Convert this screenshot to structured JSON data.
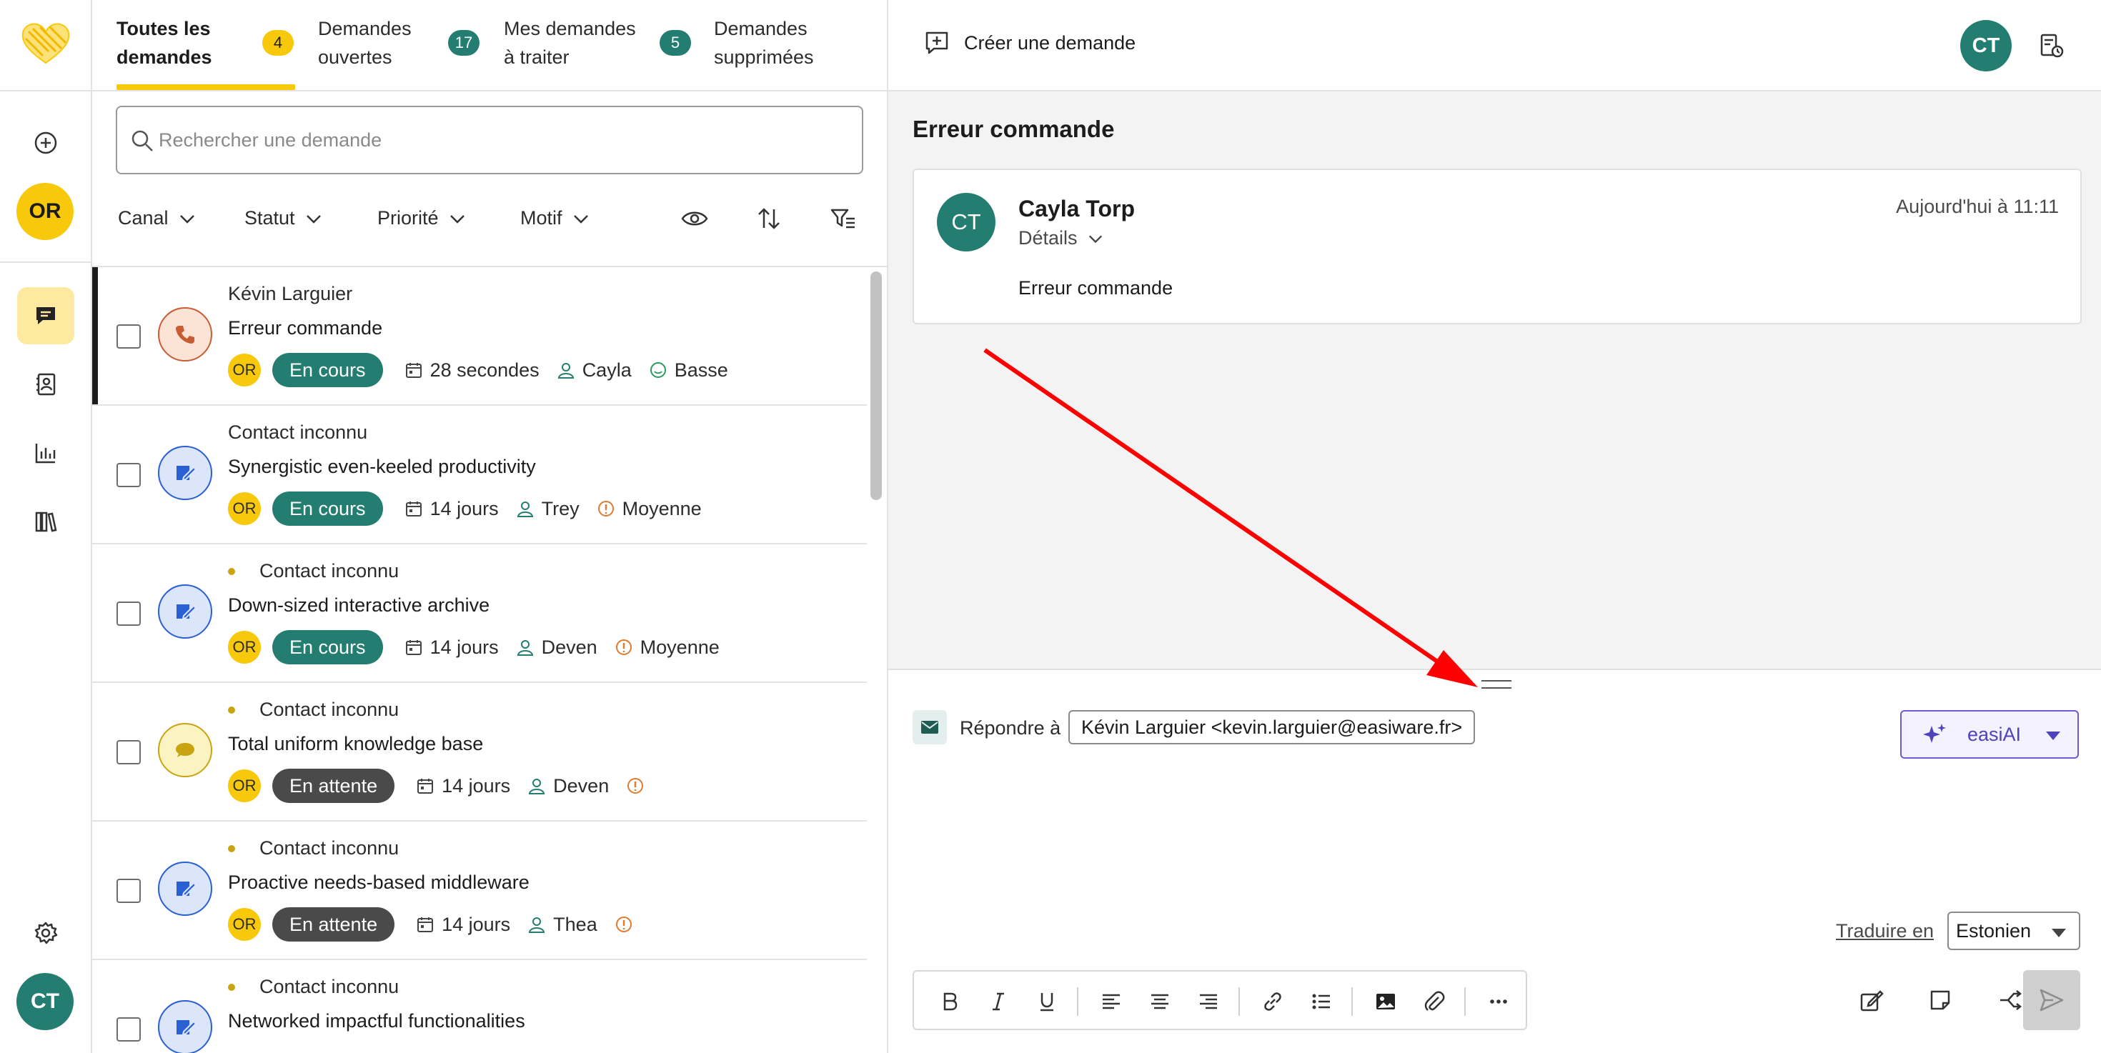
{
  "rail": {
    "user_initials": "OR",
    "agent_initials": "CT",
    "icons": [
      "add-circle-icon",
      "chat-icon",
      "contacts-icon",
      "stats-icon",
      "library-icon",
      "gear-icon"
    ]
  },
  "tabs": [
    {
      "label_line1": "Toutes les",
      "label_line2": "demandes",
      "count": "4"
    },
    {
      "label_line1": "Demandes",
      "label_line2": "ouvertes",
      "count": "17"
    },
    {
      "label_line1": "Mes demandes",
      "label_line2": "à traiter",
      "count": "5"
    },
    {
      "label_line1": "Demandes",
      "label_line2": "supprimées",
      "count": ""
    }
  ],
  "search": {
    "placeholder": "Rechercher une demande"
  },
  "filters": [
    "Canal",
    "Statut",
    "Priorité",
    "Motif"
  ],
  "requests": [
    {
      "contact": "Kévin Larguier",
      "subject": "Erreur commande",
      "owner": "OR",
      "status": "En cours",
      "age": "28 secondes",
      "assignee": "Cayla",
      "priority": "Basse",
      "channel": "phone",
      "unread": false
    },
    {
      "contact": "Contact inconnu",
      "subject": "Synergistic even-keeled productivity",
      "owner": "OR",
      "status": "En cours",
      "age": "14 jours",
      "assignee": "Trey",
      "priority": "Moyenne",
      "channel": "web",
      "unread": false
    },
    {
      "contact": "Contact inconnu",
      "subject": "Down-sized interactive archive",
      "owner": "OR",
      "status": "En cours",
      "age": "14 jours",
      "assignee": "Deven",
      "priority": "Moyenne",
      "channel": "web",
      "unread": true
    },
    {
      "contact": "Contact inconnu",
      "subject": "Total uniform knowledge base",
      "owner": "OR",
      "status": "En attente",
      "age": "14 jours",
      "assignee": "Deven",
      "priority": "",
      "channel": "chat",
      "unread": true
    },
    {
      "contact": "Contact inconnu",
      "subject": "Proactive needs-based middleware",
      "owner": "OR",
      "status": "En attente",
      "age": "14 jours",
      "assignee": "Thea",
      "priority": "",
      "channel": "web",
      "unread": true
    },
    {
      "contact": "Contact inconnu",
      "subject": "Networked impactful functionalities",
      "owner": "",
      "status": "",
      "age": "",
      "assignee": "",
      "priority": "",
      "channel": "web",
      "unread": true
    }
  ],
  "header": {
    "create_label": "Créer une demande",
    "agent_initials": "CT"
  },
  "conversation": {
    "title": "Erreur commande",
    "message": {
      "initials": "CT",
      "author": "Cayla Torp",
      "details_label": "Détails",
      "time": "Aujourd'hui à 11:11",
      "body": "Erreur commande"
    }
  },
  "reply": {
    "label": "Répondre à",
    "recipient": "Kévin Larguier <kevin.larguier@easiware.fr>",
    "ai_label": "easiAI",
    "translate_label": "Traduire en",
    "language": "Estonien"
  },
  "colors": {
    "accent_yellow": "#f8c80a",
    "teal": "#237d70",
    "annotation_red": "#ff0000"
  }
}
